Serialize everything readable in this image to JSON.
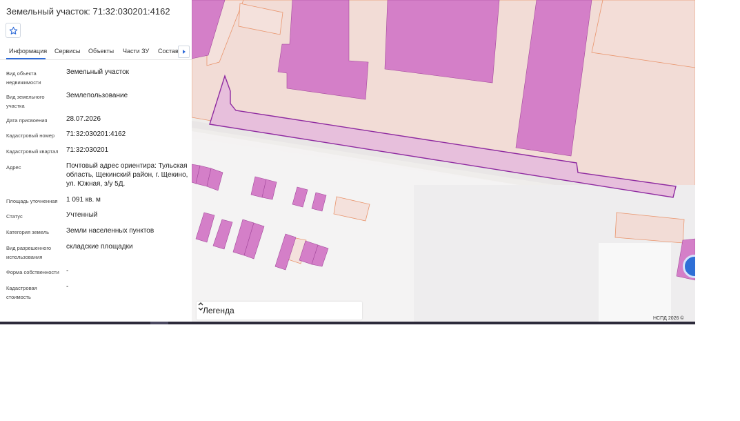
{
  "panel": {
    "title": "Земельный участок: 71:32:030201:4162",
    "favorite_icon": "star-outline-icon"
  },
  "tabs": [
    {
      "label": "Информация",
      "active": true
    },
    {
      "label": "Сервисы"
    },
    {
      "label": "Объекты"
    },
    {
      "label": "Части ЗУ"
    },
    {
      "label": "Состав"
    }
  ],
  "tab_scroll_icon": "triangle-right-icon",
  "fields": [
    {
      "label": "Вид объекта недвижимости",
      "value": "Земельный участок"
    },
    {
      "label": "Вид земельного участка",
      "value": "Землепользование"
    },
    {
      "label": "Дата присвоения",
      "value": "28.07.2026"
    },
    {
      "label": "Кадастровый номер",
      "value": "71:32:030201:4162"
    },
    {
      "label": "Кадастровый квартал",
      "value": "71:32:030201"
    },
    {
      "label": "Адрес",
      "value": "Почтовый адрес ориентира: Тульская область, Щекинский район, г. Щекино, ул. Южная, з/у 5Д."
    },
    {
      "label": "Площадь уточненная",
      "value": "1 091 кв. м"
    },
    {
      "label": "Статус",
      "value": "Учтенный"
    },
    {
      "label": "Категория земель",
      "value": "Земли населенных пунктов"
    },
    {
      "label": "Вид разрешенного использования",
      "value": "складские площадки"
    },
    {
      "label": "Форма собственности",
      "value": "-"
    },
    {
      "label": "Кадастровая стоимость",
      "value": "-"
    }
  ],
  "map": {
    "legend_label": "Легенда",
    "copyright": "НСПД 2026 ©",
    "colors": {
      "parcel_fill": "#f2dcd6",
      "parcel_border": "#e9956d",
      "building_fill": "#d47fc8",
      "building_border": "#a3489c",
      "selected_fill": "#e7bfdc",
      "selected_border": "#8e2aa0"
    }
  },
  "colors": {
    "accent": "#2d6ad8"
  }
}
